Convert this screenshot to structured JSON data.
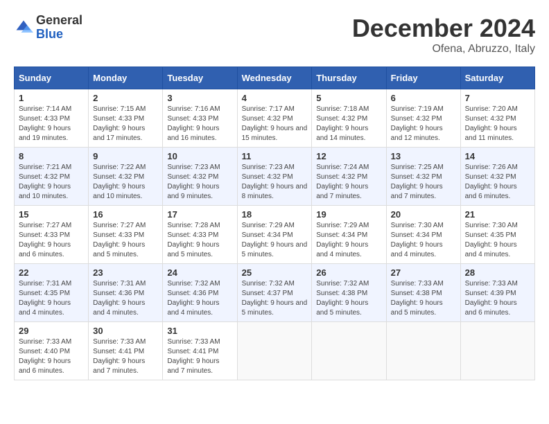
{
  "logo": {
    "general": "General",
    "blue": "Blue"
  },
  "title": "December 2024",
  "location": "Ofena, Abruzzo, Italy",
  "days_of_week": [
    "Sunday",
    "Monday",
    "Tuesday",
    "Wednesday",
    "Thursday",
    "Friday",
    "Saturday"
  ],
  "weeks": [
    [
      {
        "day": "1",
        "sunrise": "7:14 AM",
        "sunset": "4:33 PM",
        "daylight": "9 hours and 19 minutes."
      },
      {
        "day": "2",
        "sunrise": "7:15 AM",
        "sunset": "4:33 PM",
        "daylight": "9 hours and 17 minutes."
      },
      {
        "day": "3",
        "sunrise": "7:16 AM",
        "sunset": "4:33 PM",
        "daylight": "9 hours and 16 minutes."
      },
      {
        "day": "4",
        "sunrise": "7:17 AM",
        "sunset": "4:32 PM",
        "daylight": "9 hours and 15 minutes."
      },
      {
        "day": "5",
        "sunrise": "7:18 AM",
        "sunset": "4:32 PM",
        "daylight": "9 hours and 14 minutes."
      },
      {
        "day": "6",
        "sunrise": "7:19 AM",
        "sunset": "4:32 PM",
        "daylight": "9 hours and 12 minutes."
      },
      {
        "day": "7",
        "sunrise": "7:20 AM",
        "sunset": "4:32 PM",
        "daylight": "9 hours and 11 minutes."
      }
    ],
    [
      {
        "day": "8",
        "sunrise": "7:21 AM",
        "sunset": "4:32 PM",
        "daylight": "9 hours and 10 minutes."
      },
      {
        "day": "9",
        "sunrise": "7:22 AM",
        "sunset": "4:32 PM",
        "daylight": "9 hours and 10 minutes."
      },
      {
        "day": "10",
        "sunrise": "7:23 AM",
        "sunset": "4:32 PM",
        "daylight": "9 hours and 9 minutes."
      },
      {
        "day": "11",
        "sunrise": "7:23 AM",
        "sunset": "4:32 PM",
        "daylight": "9 hours and 8 minutes."
      },
      {
        "day": "12",
        "sunrise": "7:24 AM",
        "sunset": "4:32 PM",
        "daylight": "9 hours and 7 minutes."
      },
      {
        "day": "13",
        "sunrise": "7:25 AM",
        "sunset": "4:32 PM",
        "daylight": "9 hours and 7 minutes."
      },
      {
        "day": "14",
        "sunrise": "7:26 AM",
        "sunset": "4:32 PM",
        "daylight": "9 hours and 6 minutes."
      }
    ],
    [
      {
        "day": "15",
        "sunrise": "7:27 AM",
        "sunset": "4:33 PM",
        "daylight": "9 hours and 6 minutes."
      },
      {
        "day": "16",
        "sunrise": "7:27 AM",
        "sunset": "4:33 PM",
        "daylight": "9 hours and 5 minutes."
      },
      {
        "day": "17",
        "sunrise": "7:28 AM",
        "sunset": "4:33 PM",
        "daylight": "9 hours and 5 minutes."
      },
      {
        "day": "18",
        "sunrise": "7:29 AM",
        "sunset": "4:34 PM",
        "daylight": "9 hours and 5 minutes."
      },
      {
        "day": "19",
        "sunrise": "7:29 AM",
        "sunset": "4:34 PM",
        "daylight": "9 hours and 4 minutes."
      },
      {
        "day": "20",
        "sunrise": "7:30 AM",
        "sunset": "4:34 PM",
        "daylight": "9 hours and 4 minutes."
      },
      {
        "day": "21",
        "sunrise": "7:30 AM",
        "sunset": "4:35 PM",
        "daylight": "9 hours and 4 minutes."
      }
    ],
    [
      {
        "day": "22",
        "sunrise": "7:31 AM",
        "sunset": "4:35 PM",
        "daylight": "9 hours and 4 minutes."
      },
      {
        "day": "23",
        "sunrise": "7:31 AM",
        "sunset": "4:36 PM",
        "daylight": "9 hours and 4 minutes."
      },
      {
        "day": "24",
        "sunrise": "7:32 AM",
        "sunset": "4:36 PM",
        "daylight": "9 hours and 4 minutes."
      },
      {
        "day": "25",
        "sunrise": "7:32 AM",
        "sunset": "4:37 PM",
        "daylight": "9 hours and 5 minutes."
      },
      {
        "day": "26",
        "sunrise": "7:32 AM",
        "sunset": "4:38 PM",
        "daylight": "9 hours and 5 minutes."
      },
      {
        "day": "27",
        "sunrise": "7:33 AM",
        "sunset": "4:38 PM",
        "daylight": "9 hours and 5 minutes."
      },
      {
        "day": "28",
        "sunrise": "7:33 AM",
        "sunset": "4:39 PM",
        "daylight": "9 hours and 6 minutes."
      }
    ],
    [
      {
        "day": "29",
        "sunrise": "7:33 AM",
        "sunset": "4:40 PM",
        "daylight": "9 hours and 6 minutes."
      },
      {
        "day": "30",
        "sunrise": "7:33 AM",
        "sunset": "4:41 PM",
        "daylight": "9 hours and 7 minutes."
      },
      {
        "day": "31",
        "sunrise": "7:33 AM",
        "sunset": "4:41 PM",
        "daylight": "9 hours and 7 minutes."
      },
      null,
      null,
      null,
      null
    ]
  ],
  "labels": {
    "sunrise": "Sunrise:",
    "sunset": "Sunset:",
    "daylight": "Daylight:"
  }
}
